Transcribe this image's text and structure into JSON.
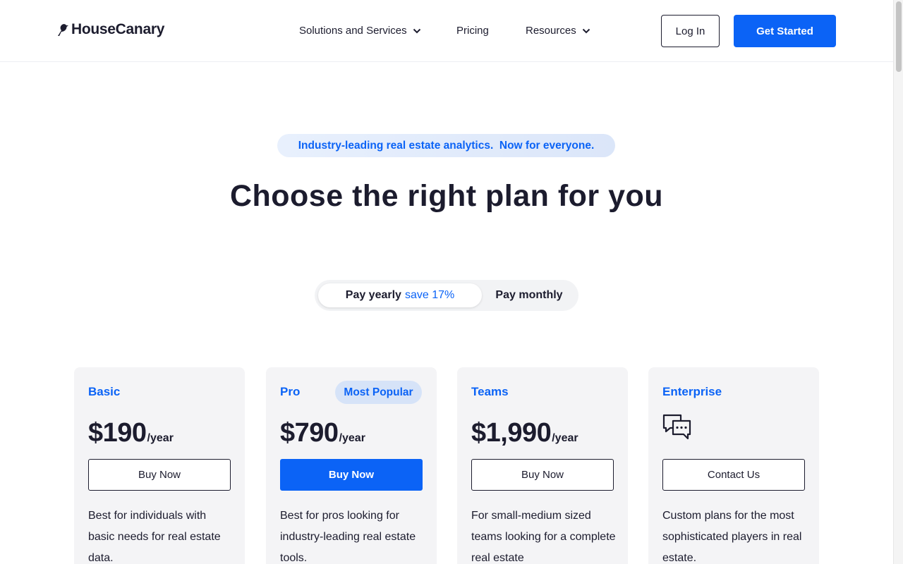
{
  "header": {
    "logo_text": "HouseCanary",
    "nav": [
      {
        "label": "Solutions and Services",
        "has_dropdown": true
      },
      {
        "label": "Pricing",
        "has_dropdown": false
      },
      {
        "label": "Resources",
        "has_dropdown": true
      }
    ],
    "login_label": "Log In",
    "get_started_label": "Get Started"
  },
  "hero": {
    "pill_text": "Industry-leading real estate analytics.  Now for everyone.",
    "title": "Choose the right plan for you"
  },
  "billing_toggle": {
    "yearly_label": "Pay yearly",
    "yearly_save": "save 17%",
    "monthly_label": "Pay monthly",
    "selected": "yearly"
  },
  "plans": [
    {
      "name": "Basic",
      "price": "$190",
      "period": "/year",
      "button": "Buy Now",
      "description": "Best for individuals with basic needs for real estate data."
    },
    {
      "name": "Pro",
      "badge": "Most Popular",
      "price": "$790",
      "period": "/year",
      "button": "Buy Now",
      "description": "Best for pros looking for industry-leading real estate tools."
    },
    {
      "name": "Teams",
      "price": "$1,990",
      "period": "/year",
      "button": "Buy Now",
      "description": "For small-medium sized teams looking for a complete real estate"
    },
    {
      "name": "Enterprise",
      "icon": "chat-bubbles-icon",
      "button": "Contact Us",
      "description": "Custom plans for the most sophisticated players in real estate."
    }
  ],
  "colors": {
    "accent": "#0b63f6",
    "text": "#1c1c2e",
    "card_bg": "#f4f4f6"
  }
}
